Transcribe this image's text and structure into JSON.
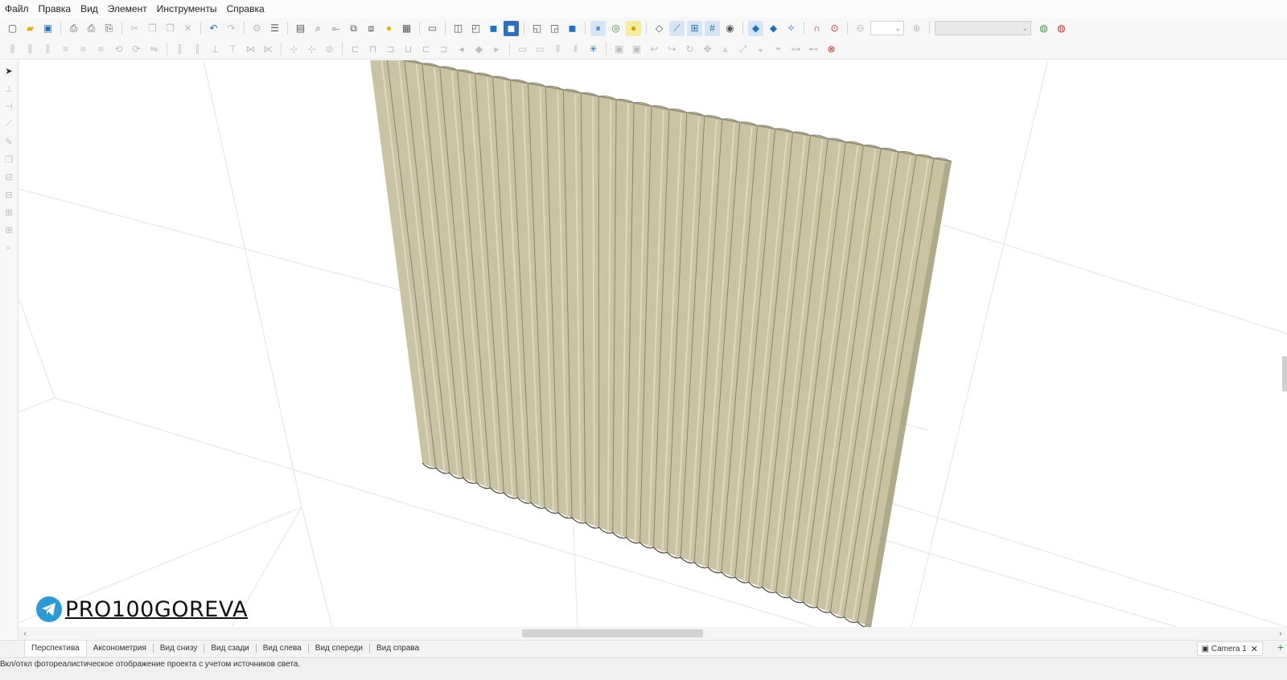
{
  "menu": [
    "Файл",
    "Правка",
    "Вид",
    "Элемент",
    "Инструменты",
    "Справка"
  ],
  "toolbar_icons": [
    "new-file",
    "open-folder",
    "save",
    "print-preview",
    "print",
    "print-setup",
    "cut",
    "copy",
    "paste",
    "delete",
    "undo",
    "redo",
    "settings",
    "properties",
    "page",
    "find",
    "connect",
    "group",
    "ungroup",
    "light",
    "texture",
    "calculator",
    "view-front-box",
    "view-box",
    "shaded-box",
    "solid-box",
    "wire-box",
    "edge-box",
    "render-box",
    "section",
    "clip",
    "render-light",
    "measure",
    "snap-line",
    "snap-grid",
    "grid",
    "visibility",
    "snap-point",
    "snap-vertex",
    "snap-center",
    "magnet",
    "record",
    "zoom-out",
    "zoom-in"
  ],
  "zoom_value": "",
  "layer_value": "",
  "viewport": {
    "watermark": "PRO100GOREVA",
    "panel": {
      "color": "#c9c3a4",
      "flute_count": 33
    }
  },
  "tabs": [
    "Перспектива",
    "Аксонометрия",
    "Вид снизу",
    "Вид сзади",
    "Вид слева",
    "Вид спереди",
    "Вид справа"
  ],
  "camera_label": "Camera 1",
  "status_text": "Вкл/откл фотореалистическое отображение проекта с учетом источников света."
}
